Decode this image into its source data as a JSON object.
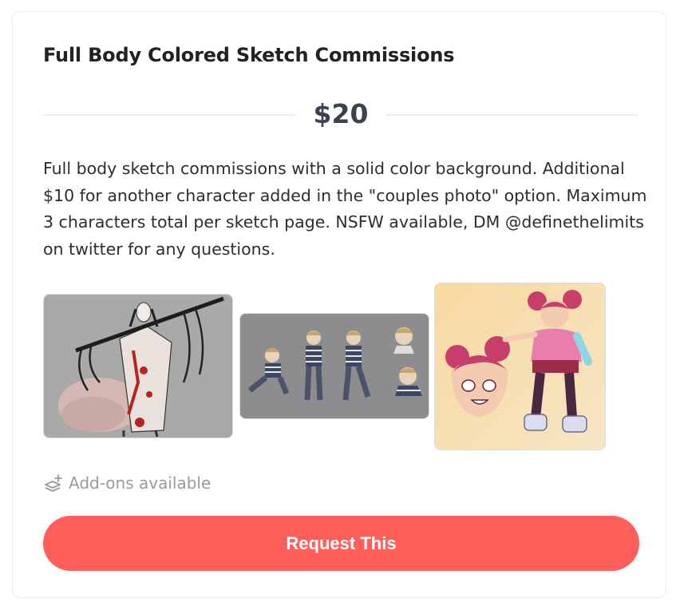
{
  "card": {
    "title": "Full Body Colored Sketch Commissions",
    "price": "$20",
    "description": "Full body sketch commissions with a solid color background. Additional $10 for another character added in the \"couples photo\" option. Maximum 3 characters total per sketch page. NSFW available, DM @definethelimits on twitter for any questions.",
    "addons_label": "Add-ons available",
    "addons_icon": "layers-plus-icon",
    "request_label": "Request This"
  },
  "gallery": [
    {
      "name": "thumbnail-figure-with-staff"
    },
    {
      "name": "thumbnail-boy-sketches"
    },
    {
      "name": "thumbnail-girl-pink-hair"
    }
  ],
  "colors": {
    "accent": "#ff5e5b",
    "title": "#222222",
    "price": "#3b4350",
    "body_text": "#2d2d2d",
    "muted": "#9a9a9a",
    "divider": "#ececec"
  }
}
